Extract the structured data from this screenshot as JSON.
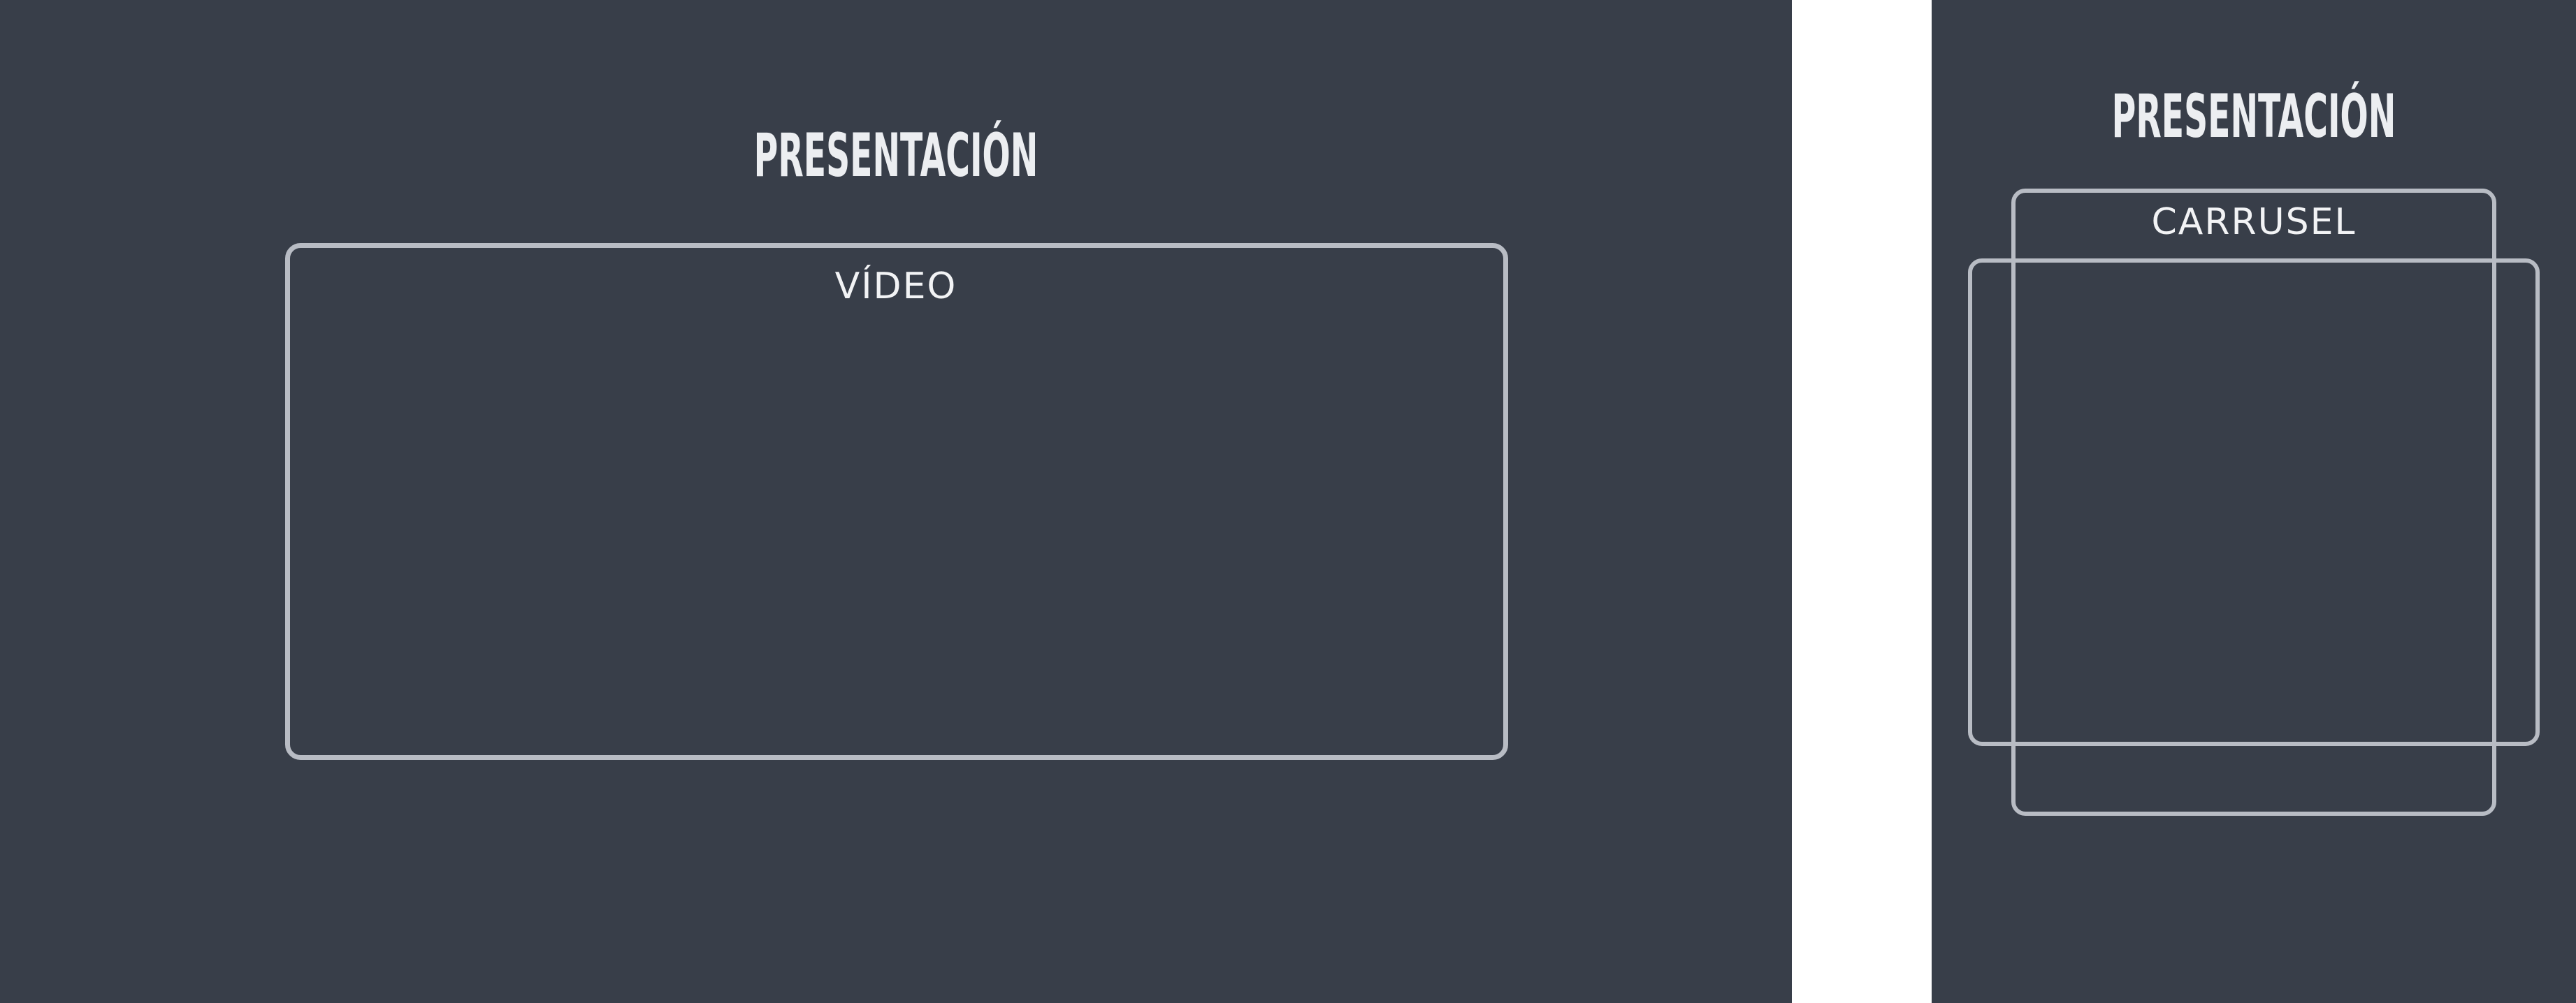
{
  "left_panel": {
    "title": "PRESENTACIÓN",
    "frame_label": "VÍDEO"
  },
  "right_panel": {
    "title": "PRESENTACIÓN",
    "frame_label": "CARRUSEL"
  },
  "colors": {
    "panel_background": "#383e49",
    "page_background": "#ffffff",
    "frame_border": "#b8bcc4",
    "text": "#eceef1"
  }
}
